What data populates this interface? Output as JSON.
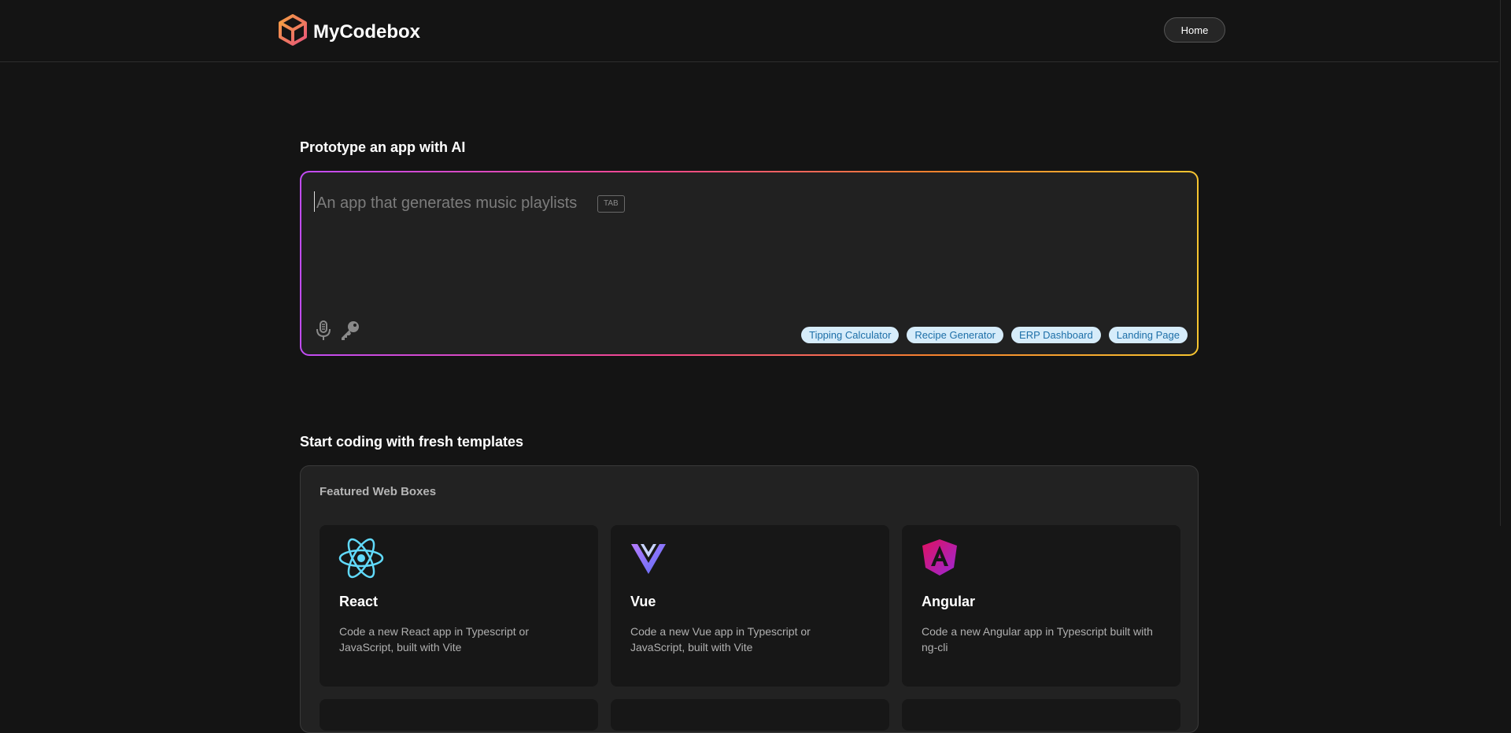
{
  "header": {
    "brand": "MyCodebox",
    "home_label": "Home"
  },
  "prototype": {
    "title": "Prototype an app with AI",
    "placeholder": "An app that generates music playlists",
    "tab_hint": "TAB",
    "chips": [
      "Tipping Calculator",
      "Recipe Generator",
      "ERP Dashboard",
      "Landing Page"
    ]
  },
  "templates": {
    "title": "Start coding with fresh templates",
    "featured_title": "Featured Web Boxes",
    "cards": [
      {
        "name": "React",
        "desc": "Code a new React app in Typescript or JavaScript, built with Vite",
        "icon": "react-icon"
      },
      {
        "name": "Vue",
        "desc": "Code a new Vue app in Typescript or JavaScript, built with Vite",
        "icon": "vue-icon"
      },
      {
        "name": "Angular",
        "desc": "Code a new Angular app in Typescript built with ng-cli",
        "icon": "angular-icon"
      }
    ]
  },
  "colors": {
    "background": "#141414",
    "chip_bg": "#d6ecfa",
    "chip_text": "#1d6fa8",
    "gradient": [
      "#c14cf5",
      "#f4478b",
      "#f5812e",
      "#f7c530"
    ],
    "react": "#61dafb",
    "angular": "#e0115f"
  }
}
